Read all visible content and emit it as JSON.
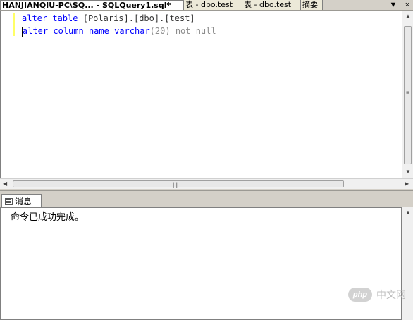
{
  "tabs": [
    {
      "label": "HANJIANQIU-PC\\SQ... - SQLQuery1.sql*",
      "active": true
    },
    {
      "label": "表 - dbo.test",
      "active": false
    },
    {
      "label": "表 - dbo.test",
      "active": false
    },
    {
      "label": "摘要",
      "active": false
    }
  ],
  "tab_controls": {
    "dropdown": "▼",
    "close": "×"
  },
  "editor": {
    "line1": {
      "kw1": "alter",
      "kw2": "table",
      "text": "[Polaris].[dbo].[test]"
    },
    "line2": {
      "kw1": "alter",
      "kw2": "column",
      "name": "name",
      "type": "varchar",
      "size": "(20)",
      "rest": "not null"
    }
  },
  "results_tab": {
    "label": "消息"
  },
  "results": {
    "message": "命令已成功完成。"
  },
  "watermark": {
    "badge": "php",
    "text": "中文网"
  },
  "colors": {
    "keyword": "#0000ff",
    "gray": "#8c8c8c",
    "marker": "#ffff66"
  }
}
